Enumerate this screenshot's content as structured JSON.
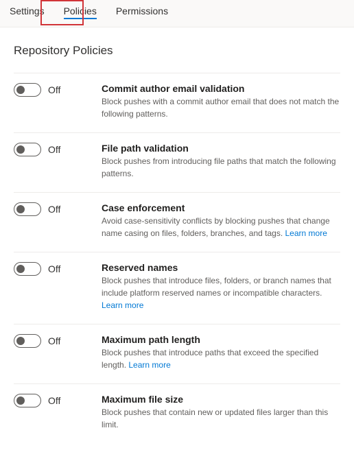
{
  "tabs": {
    "settings": "Settings",
    "policies": "Policies",
    "permissions": "Permissions"
  },
  "page_title": "Repository Policies",
  "toggle_off_label": "Off",
  "learn_more": "Learn more",
  "policies": {
    "commit_author": {
      "title": "Commit author email validation",
      "desc": "Block pushes with a commit author email that does not match the following patterns."
    },
    "file_path": {
      "title": "File path validation",
      "desc": "Block pushes from introducing file paths that match the following patterns."
    },
    "case_enforcement": {
      "title": "Case enforcement",
      "desc": "Avoid case-sensitivity conflicts by blocking pushes that change name casing on files, folders, branches, and tags."
    },
    "reserved_names": {
      "title": "Reserved names",
      "desc": "Block pushes that introduce files, folders, or branch names that include platform reserved names or incompatible characters."
    },
    "max_path": {
      "title": "Maximum path length",
      "desc": "Block pushes that introduce paths that exceed the specified length."
    },
    "max_file_size": {
      "title": "Maximum file size",
      "desc": "Block pushes that contain new or updated files larger than this limit."
    }
  }
}
